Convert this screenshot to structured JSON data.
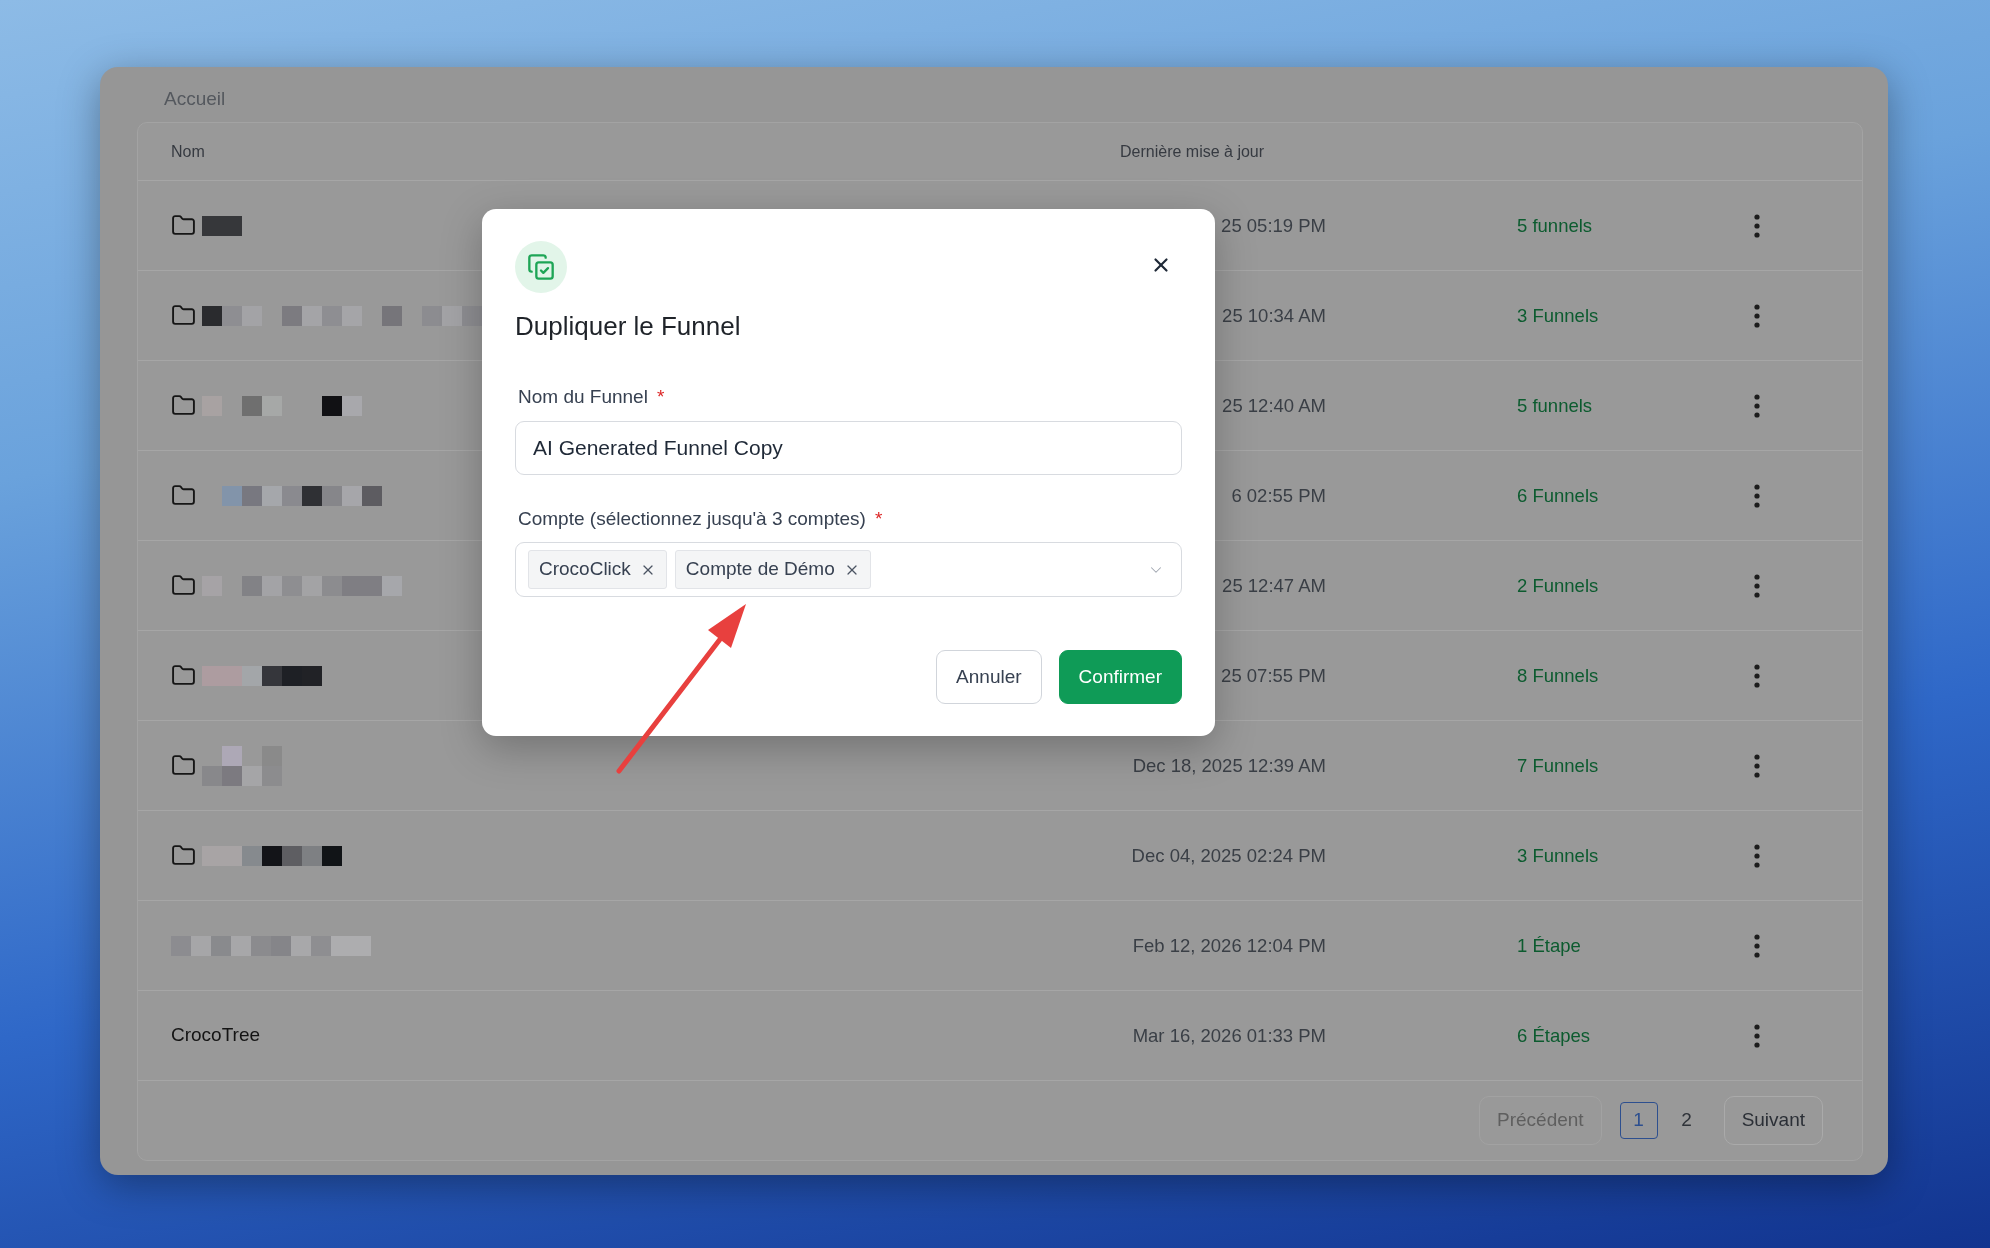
{
  "window": {
    "breadcrumb": "Accueil"
  },
  "table": {
    "columns": [
      "Nom",
      "Dernière mise à jour"
    ],
    "rows": [
      {
        "kind": "folder",
        "name_redacted": true,
        "updated": "25 05:19 PM",
        "count": "5 funnels"
      },
      {
        "kind": "folder",
        "name_redacted": true,
        "updated": "25 10:34 AM",
        "count": "3 Funnels"
      },
      {
        "kind": "folder",
        "name_redacted": true,
        "updated": "25 12:40 AM",
        "count": "5 funnels"
      },
      {
        "kind": "folder",
        "name_redacted": true,
        "updated": "6 02:55 PM",
        "count": "6 Funnels"
      },
      {
        "kind": "folder",
        "name_redacted": true,
        "updated": "25 12:47 AM",
        "count": "2 Funnels"
      },
      {
        "kind": "folder",
        "name_redacted": true,
        "updated": "25 07:55 PM",
        "count": "8 Funnels"
      },
      {
        "kind": "folder",
        "name_redacted": true,
        "updated": "Dec 18, 2025 12:39 AM",
        "count": "7 Funnels"
      },
      {
        "kind": "folder",
        "name_redacted": true,
        "updated": "Dec 04, 2025 02:24 PM",
        "count": "3 Funnels"
      },
      {
        "kind": "item",
        "name_redacted": true,
        "updated": "Feb 12, 2026 12:04 PM",
        "count": "1 Étape"
      },
      {
        "kind": "item",
        "name_redacted": false,
        "name": "CrocoTree",
        "updated": "Mar 16, 2026 01:33 PM",
        "count": "6 Étapes"
      }
    ]
  },
  "pagination": {
    "previous": {
      "label": "Précédent",
      "disabled": true
    },
    "pages": [
      {
        "label": "1",
        "selected": true
      },
      {
        "label": "2",
        "selected": false
      }
    ],
    "next": {
      "label": "Suivant",
      "disabled": false
    }
  },
  "dialog": {
    "title": "Dupliquer le Funnel",
    "fields": [
      {
        "kind": "text",
        "label": "Nom du Funnel",
        "required_mark": "*",
        "value": "AI Generated Funnel Copy"
      },
      {
        "kind": "multiselect",
        "label": "Compte (sélectionnez jusqu'à 3 comptes)",
        "required_mark": "*",
        "tags": [
          "CrocoClick",
          "Compte de Démo"
        ]
      }
    ],
    "buttons": [
      {
        "kind": "secondary",
        "label": "Annuler"
      },
      {
        "kind": "primary",
        "label": "Confirmer"
      }
    ]
  }
}
